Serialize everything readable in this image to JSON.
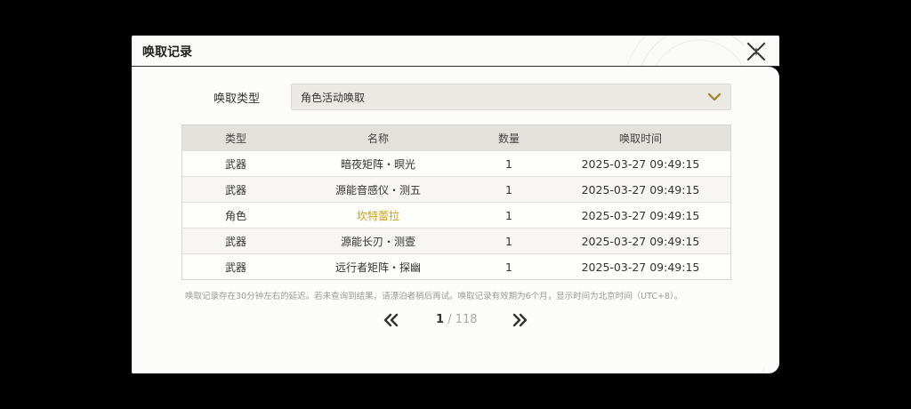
{
  "dialog": {
    "title": "唤取记录"
  },
  "filter": {
    "label": "唤取类型",
    "selected": "角色活动唤取"
  },
  "table": {
    "headers": [
      "类型",
      "名称",
      "数量",
      "唤取时间"
    ],
    "rows": [
      {
        "type": "武器",
        "name": "暗夜矩阵・暝光",
        "qty": "1",
        "time": "2025-03-27 09:49:15"
      },
      {
        "type": "武器",
        "name": "源能音感仪・测五",
        "qty": "1",
        "time": "2025-03-27 09:49:15"
      },
      {
        "type": "角色",
        "name": "坎特蕾拉",
        "qty": "1",
        "time": "2025-03-27 09:49:15",
        "highlight": "#c9a21a"
      },
      {
        "type": "武器",
        "name": "源能长刃・测壹",
        "qty": "1",
        "time": "2025-03-27 09:49:15"
      },
      {
        "type": "武器",
        "name": "远行者矩阵・探幽",
        "qty": "1",
        "time": "2025-03-27 09:49:15"
      }
    ]
  },
  "footnote": "唤取记录存在30分钟左右的延迟。若未查询到结果，请漂泊者稍后再试。唤取记录有效期为6个月，显示时间为北京时间（UTC+8）。",
  "pager": {
    "current": "1",
    "separator": "/",
    "total": "118"
  },
  "icons": {
    "close": "close-icon",
    "dropdown": "chevron-down-icon",
    "prev": "double-chevron-left-icon",
    "next": "double-chevron-right-icon"
  },
  "colors": {
    "accent_gold": "#c9a21a",
    "dropdown_chevron": "#a68a2e"
  }
}
